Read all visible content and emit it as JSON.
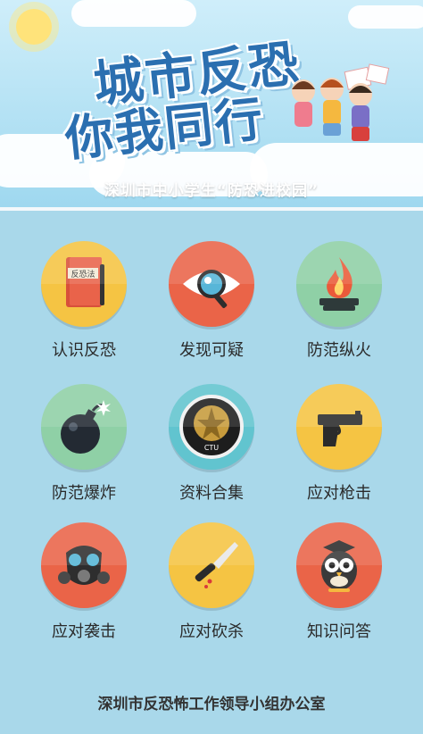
{
  "banner": {
    "title_line1": "城市反恐",
    "title_line2": "你我同行",
    "subtitle": "深圳市中小学生“防恐进校园”"
  },
  "icons": {
    "book_label": "反恐法",
    "emblem_text": "CTU"
  },
  "menu": {
    "items": [
      {
        "label": "认识反恐",
        "icon": "book-icon",
        "color": "#f5c443"
      },
      {
        "label": "发现可疑",
        "icon": "eye-icon",
        "color": "#ea6448"
      },
      {
        "label": "防范纵火",
        "icon": "fire-icon",
        "color": "#8fd0a6"
      },
      {
        "label": "防范爆炸",
        "icon": "bomb-icon",
        "color": "#8fd0a6"
      },
      {
        "label": "资料合集",
        "icon": "emblem-icon",
        "color": "#61c4cf"
      },
      {
        "label": "应对枪击",
        "icon": "gun-icon",
        "color": "#f5c443"
      },
      {
        "label": "应对袭击",
        "icon": "gas-mask-icon",
        "color": "#ea6448"
      },
      {
        "label": "应对砍杀",
        "icon": "knife-icon",
        "color": "#f5c443"
      },
      {
        "label": "知识问答",
        "icon": "owl-icon",
        "color": "#ea6448"
      }
    ]
  },
  "footer": {
    "text": "深圳市反恐怖工作领导小组办公室"
  }
}
